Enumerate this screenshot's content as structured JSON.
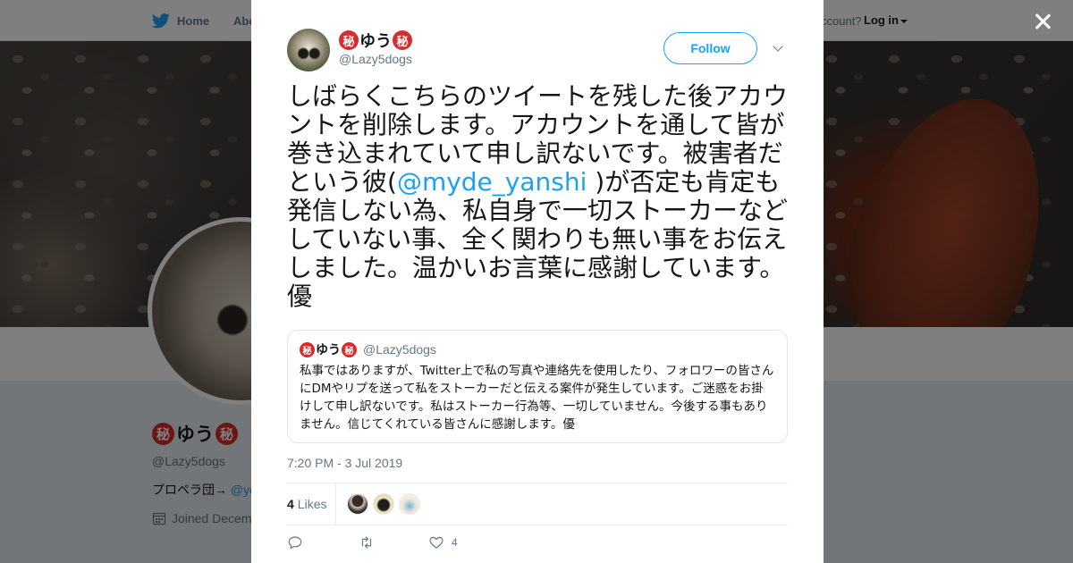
{
  "nav": {
    "home": "Home",
    "about": "Abo",
    "account": "ccount?",
    "login": "Log in"
  },
  "profile": {
    "name_text": "ゆう",
    "secret_glyph": "秘",
    "handle": "@Lazy5dogs",
    "bio_prefix": "プロペラ団→",
    "bio_link": "@yo",
    "joined": "Joined Decem"
  },
  "tweet": {
    "author": {
      "name_text": "ゆう",
      "secret_glyph": "秘",
      "handle": "@Lazy5dogs"
    },
    "follow_label": "Follow",
    "text_before": "しばらくこちらのツイートを残した後アカウントを削除します。アカウントを通して皆が巻き込まれていて申し訳ないです。被害者だという彼(",
    "mention": "@myde_yanshi",
    "text_after": " )が否定も肯定も発信しない為、私自身で一切ストーカーなどしていない事、全く関わりも無い事をお伝えしました。温かいお言葉に感謝しています。優",
    "quoted": {
      "name_text": "ゆう",
      "secret_glyph": "秘",
      "handle": "@Lazy5dogs",
      "text": "私事ではありますが、Twitter上で私の写真や連絡先を使用したり、フォロワーの皆さんにDMやリプを送って私をストーカーだと伝える案件が発生しています。ご迷惑をお掛けして申し訳ないです。私はストーカー行為等、一切していません。今後する事もありません。信じてくれている皆さんに感謝します。優"
    },
    "timestamp": "7:20 PM - 3 Jul 2019",
    "likes_count": "4",
    "likes_label": "Likes",
    "action_like_count": "4"
  },
  "colors": {
    "accent": "#1da1f2",
    "secret_badge": "#d92b2b",
    "muted": "#657786"
  },
  "icons": [
    "twitter-bird-icon",
    "close-icon",
    "chevron-down-icon",
    "calendar-icon",
    "reply-icon",
    "retweet-icon",
    "heart-icon"
  ]
}
